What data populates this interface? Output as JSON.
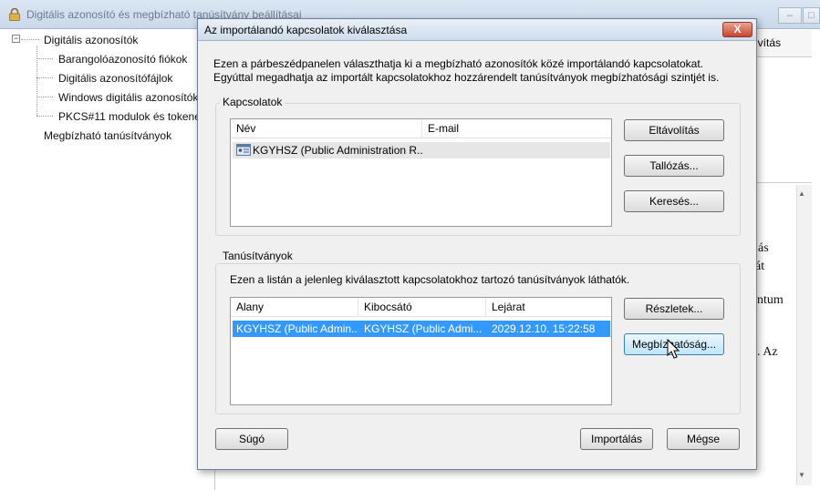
{
  "background_window": {
    "title": "Digitális azonosító és megbízható tanúsítvány beállításai",
    "tab_label": "lvítás",
    "tree": {
      "root": "Digitális azonosítók",
      "children": [
        "Barangolóazonosító fiókok",
        "Digitális azonosítófájlok",
        "Windows digitális azonosítók",
        "PKCS#11 modulok és tokenek"
      ],
      "sibling": "Megbízható tanúsítványok"
    },
    "fragments": [
      "ás",
      "át",
      "ntum",
      ". Az"
    ]
  },
  "dialog": {
    "title": "Az importálandó kapcsolatok kiválasztása",
    "close_label": "X",
    "intro": "Ezen a párbeszédpanelen választhatja ki a megbízható azonosítók közé importálandó kapcsolatokat. Egyúttal megadhatja az importált kapcsolatokhoz hozzárendelt tanúsítványok megbízhatósági szintjét is.",
    "contacts": {
      "legend": "Kapcsolatok",
      "columns": [
        "Név",
        "E-mail"
      ],
      "rows": [
        {
          "name": "KGYHSZ (Public Administration R...",
          "email": ""
        }
      ],
      "buttons": {
        "remove": "Eltávolítás",
        "browse": "Tallózás...",
        "search": "Keresés..."
      }
    },
    "certificates": {
      "legend": "Tanúsítványok",
      "description": "Ezen a listán a jelenleg kiválasztott kapcsolatokhoz tartozó tanúsítványok láthatók.",
      "columns": [
        "Alany",
        "Kibocsátó",
        "Lejárat"
      ],
      "rows": [
        {
          "subject": "KGYHSZ (Public Admin...",
          "issuer": "KGYHSZ (Public Admi...",
          "expires": "2029.12.10. 15:22:58"
        }
      ],
      "buttons": {
        "details": "Részletek...",
        "trust": "Megbízhatóság..."
      }
    },
    "footer": {
      "help": "Súgó",
      "import": "Importálás",
      "cancel": "Mégse"
    }
  },
  "colors": {
    "selection": "#3399ff",
    "contact_row_bg": "#e6e6e6",
    "dialog_bg": "#f0f0f0"
  }
}
